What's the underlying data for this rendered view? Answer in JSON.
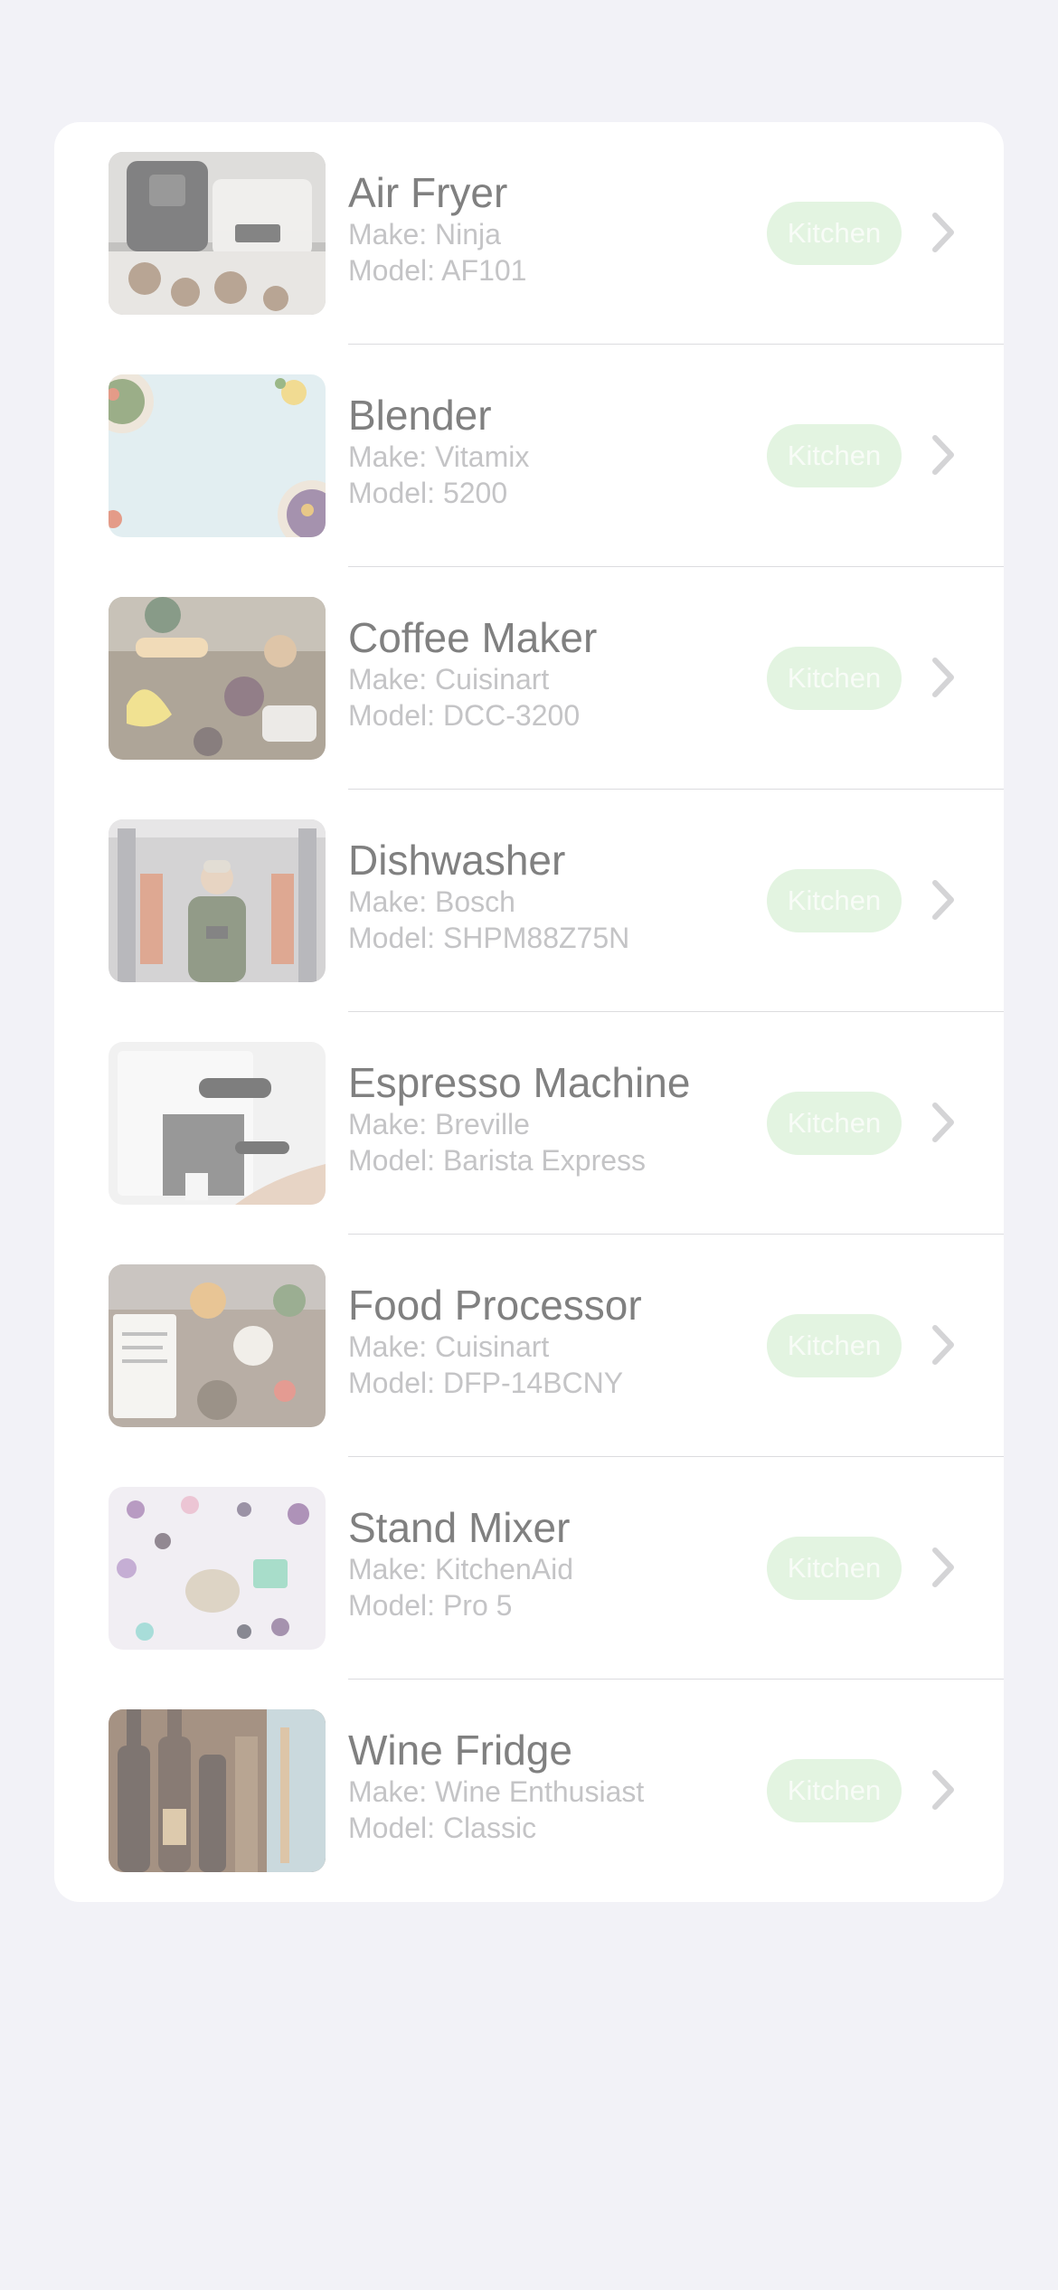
{
  "colors": {
    "background": "#f2f2f7",
    "card": "#ffffff",
    "badge_bg": "#e3f4e1",
    "badge_text": "#f8fcf7",
    "title_text": "#808080",
    "subtitle_text": "#c4c4c6",
    "chevron": "#d4d4d6"
  },
  "appliances": [
    {
      "name": "Air Fryer",
      "make": "Make: Ninja",
      "model": "Model: AF101",
      "category": "Kitchen",
      "image_icon": "air-fryer-photo"
    },
    {
      "name": "Blender",
      "make": "Make: Vitamix",
      "model": "Model: 5200",
      "category": "Kitchen",
      "image_icon": "food-flatlay-photo"
    },
    {
      "name": "Coffee Maker",
      "make": "Make: Cuisinart",
      "model": "Model: DCC-3200",
      "category": "Kitchen",
      "image_icon": "charcuterie-photo"
    },
    {
      "name": "Dishwasher",
      "make": "Make: Bosch",
      "model": "Model: SHPM88Z75N",
      "category": "Kitchen",
      "image_icon": "warehouse-person-photo"
    },
    {
      "name": "Espresso Machine",
      "make": "Make: Breville",
      "model": "Model: Barista Express",
      "category": "Kitchen",
      "image_icon": "espresso-machine-photo"
    },
    {
      "name": "Food Processor",
      "make": "Make: Cuisinart",
      "model": "Model: DFP-14BCNY",
      "category": "Kitchen",
      "image_icon": "dining-table-photo"
    },
    {
      "name": "Stand Mixer",
      "make": "Make: KitchenAid",
      "model": "Model: Pro 5",
      "category": "Kitchen",
      "image_icon": "gemstones-photo"
    },
    {
      "name": "Wine Fridge",
      "make": "Make: Wine Enthusiast",
      "model": "Model: Classic",
      "category": "Kitchen",
      "image_icon": "wine-bottles-photo"
    }
  ]
}
